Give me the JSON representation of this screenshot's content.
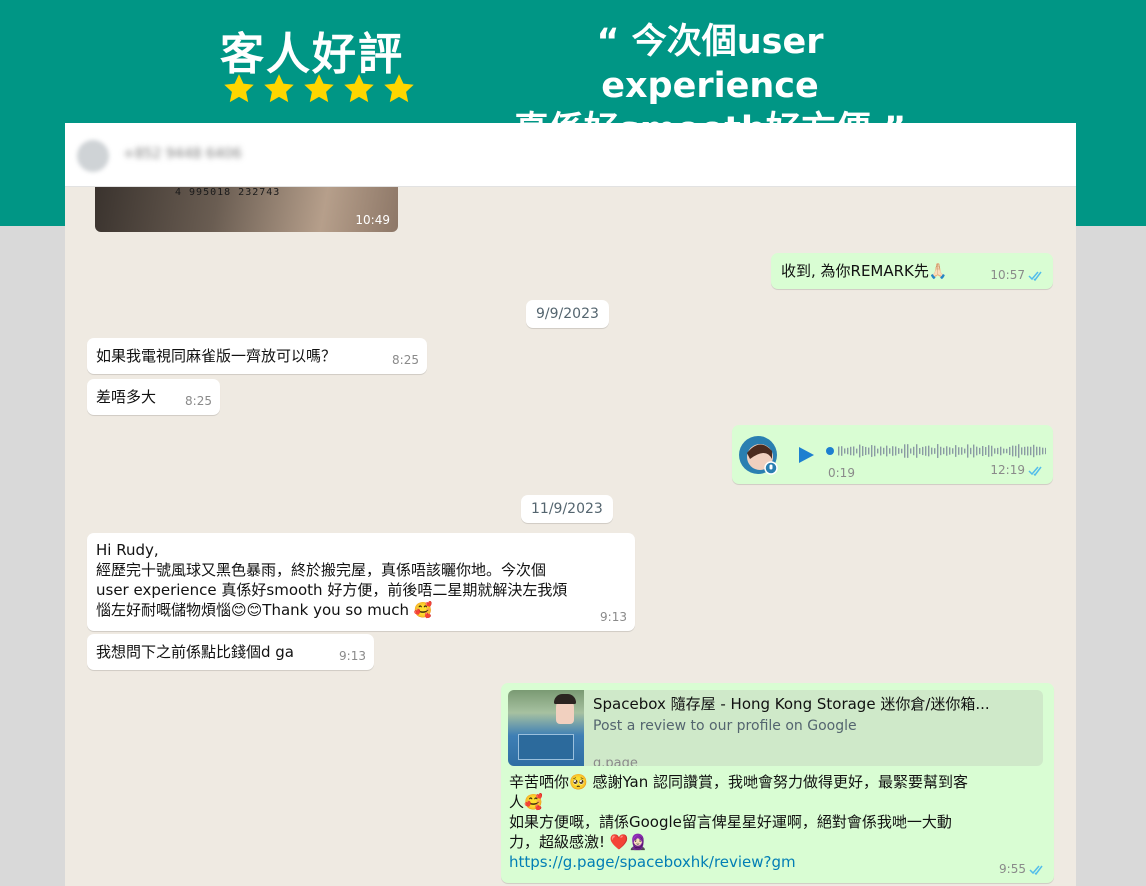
{
  "banner": {
    "title": "客人好評",
    "quote_line1": "“ 今次個user experience",
    "quote_line2": "真係好smooth好方便 ”",
    "colors": {
      "background": "#009685",
      "star": "#ffd600"
    },
    "rating_stars": 5
  },
  "chat": {
    "contact_name": "+852 9448 6406",
    "photo": {
      "caption": "4 995018 232743",
      "time": "10:49"
    },
    "messages": [
      {
        "dir": "out",
        "text": "收到, 為你REMARK先🙏🏻",
        "time": "10:57"
      },
      {
        "type": "date",
        "text": "9/9/2023"
      },
      {
        "dir": "in",
        "text": "如果我電視同麻雀版一齊放可以嗎？",
        "time": "8:25"
      },
      {
        "dir": "in",
        "text": "差唔多大",
        "time": "8:25"
      },
      {
        "dir": "out",
        "type": "voice",
        "duration": "0:19",
        "time": "12:19"
      },
      {
        "type": "date",
        "text": "11/9/2023"
      },
      {
        "dir": "in",
        "lines": [
          "Hi Rudy,",
          "經歷完十號風球又黑色暴雨，終於搬完屋，真係唔該曬你地。今次個",
          "user experience 真係好smooth 好方便，前後唔二星期就解決左我煩",
          "惱左好耐嘅儲物煩惱😊😊Thank you so much 🥰"
        ],
        "time": "9:13"
      },
      {
        "dir": "in",
        "text": "我想問下之前係點比錢個d ga",
        "time": "9:13"
      },
      {
        "dir": "out",
        "type": "link",
        "card": {
          "title": "Spacebox 隨存屋 - Hong Kong Storage 迷你倉/迷你箱...",
          "description": "Post a review to our profile on Google",
          "domain": "g.page"
        },
        "lines": [
          "辛苦哂你🥺 感謝Yan 認同讚賞，我哋會努力做得更好，最緊要幫到客",
          "人🥰",
          "如果方便嘅，請係Google留言俾星星好運啊，絕對會係我哋一大動",
          "力，超級感激! ❤️🧕🏻"
        ],
        "url": "https://g.page/spaceboxhk/review?gm",
        "time": "9:55"
      }
    ]
  }
}
